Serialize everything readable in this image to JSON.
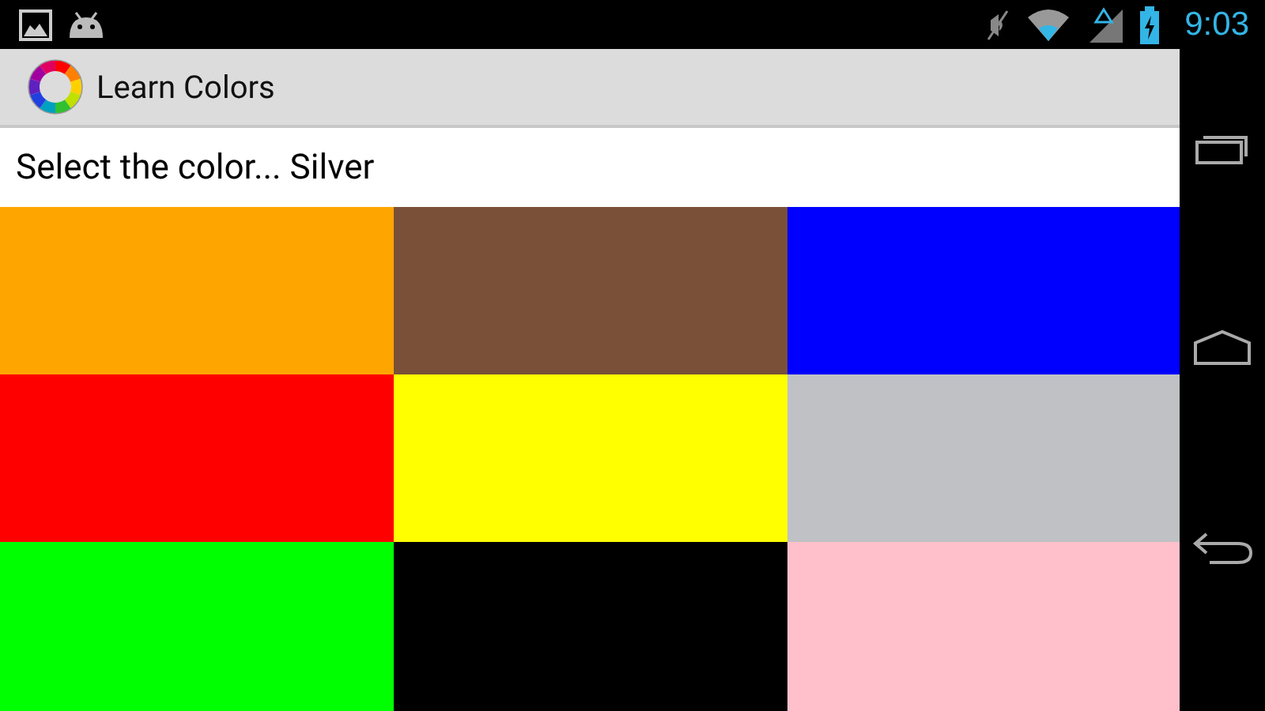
{
  "status_bar": {
    "time": "9:03"
  },
  "app_bar": {
    "title": "Learn Colors"
  },
  "prompt": "Select the color... Silver",
  "tiles": [
    {
      "color": "#ffa500"
    },
    {
      "color": "#7b5038"
    },
    {
      "color": "#0000ff"
    },
    {
      "color": "#ff0000"
    },
    {
      "color": "#ffff00"
    },
    {
      "color": "#bfc1c4"
    },
    {
      "color": "#00ff00"
    },
    {
      "color": "#000000"
    },
    {
      "color": "#ffc0cb"
    }
  ]
}
